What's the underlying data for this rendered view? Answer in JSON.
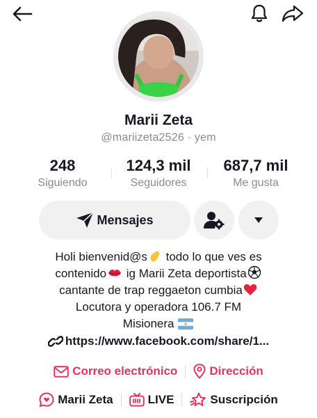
{
  "profile": {
    "name": "Marii Zeta",
    "handle": "@mariizeta2526 · yem"
  },
  "stats": [
    {
      "value": "248",
      "label": "Siguiendo"
    },
    {
      "value": "124,3 mil",
      "label": "Seguidores"
    },
    {
      "value": "687,7 mil",
      "label": "Me gusta"
    }
  ],
  "actions": {
    "message_label": "Mensajes"
  },
  "bio": {
    "line1_a": "Holi bienvenid@s",
    "line1_b": " todo lo que ves es",
    "line2_a": "contenido",
    "line2_b": " ig Marii Zeta deportista",
    "line3": "cantante de trap reggaeton cumbia",
    "line4": "Locutora y operadora 106.7 FM",
    "line5": "Misionera "
  },
  "link": {
    "text": "https://www.facebook.com/share/1..."
  },
  "contact": {
    "email_label": "Correo electrónico",
    "address_label": "Dirección"
  },
  "features": {
    "nickname_label": "Marii Zeta",
    "live_label": "LIVE",
    "subscription_label": "Suscripción"
  },
  "icons": {
    "back": "back-arrow-icon",
    "bell": "bell-icon",
    "share": "share-icon",
    "send": "send-icon",
    "user_settings": "user-settings-icon",
    "caret": "caret-down-icon",
    "link": "link-icon",
    "email": "email-icon",
    "location": "location-pin-icon",
    "chat": "chat-heart-icon",
    "live": "live-tv-icon",
    "subscription": "star-subscription-icon"
  },
  "colors": {
    "accent_pink": "#e8335c",
    "text_primary": "#161823",
    "text_secondary": "#8a8b91",
    "button_bg": "#f1f1f2"
  }
}
